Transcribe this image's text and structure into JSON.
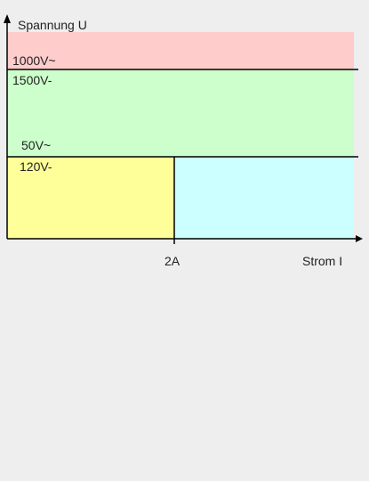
{
  "diagram": {
    "y_axis_label": "Spannung U",
    "x_axis_label": "Strom I",
    "x_tick_label": "2A",
    "labels": {
      "ac_1000": "1000V~",
      "dc_1500": "1500V-",
      "ac_50": "50V~",
      "dc_120": "120V-"
    },
    "regions": {
      "high_voltage": {
        "color": "#ffcccc"
      },
      "low_voltage": {
        "color": "#ccffcc"
      },
      "elv_low_current": {
        "color": "#ffff99"
      },
      "elv_high_current": {
        "color": "#ccffff"
      }
    },
    "colors": {
      "axis": "#000000",
      "background": "#eeeeee"
    }
  }
}
